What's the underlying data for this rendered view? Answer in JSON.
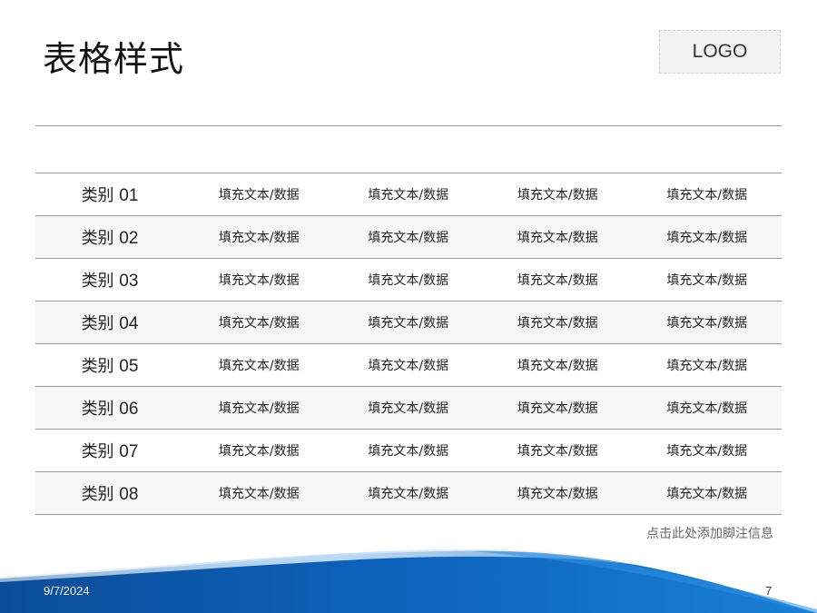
{
  "slide": {
    "title": "表格样式",
    "logo": "LOGO",
    "footnote": "点击此处添加脚注信息",
    "date": "9/7/2024",
    "page_number": "7"
  },
  "table": {
    "rows": [
      {
        "label": "类别",
        "num": "01",
        "cells": [
          "填充文本/数据",
          "填充文本/数据",
          "填充文本/数据",
          "填充文本/数据"
        ]
      },
      {
        "label": "类别",
        "num": "02",
        "cells": [
          "填充文本/数据",
          "填充文本/数据",
          "填充文本/数据",
          "填充文本/数据"
        ]
      },
      {
        "label": "类别",
        "num": "03",
        "cells": [
          "填充文本/数据",
          "填充文本/数据",
          "填充文本/数据",
          "填充文本/数据"
        ]
      },
      {
        "label": "类别",
        "num": "04",
        "cells": [
          "填充文本/数据",
          "填充文本/数据",
          "填充文本/数据",
          "填充文本/数据"
        ]
      },
      {
        "label": "类别",
        "num": "05",
        "cells": [
          "填充文本/数据",
          "填充文本/数据",
          "填充文本/数据",
          "填充文本/数据"
        ]
      },
      {
        "label": "类别",
        "num": "06",
        "cells": [
          "填充文本/数据",
          "填充文本/数据",
          "填充文本/数据",
          "填充文本/数据"
        ]
      },
      {
        "label": "类别",
        "num": "07",
        "cells": [
          "填充文本/数据",
          "填充文本/数据",
          "填充文本/数据",
          "填充文本/数据"
        ]
      },
      {
        "label": "类别",
        "num": "08",
        "cells": [
          "填充文本/数据",
          "填充文本/数据",
          "填充文本/数据",
          "填充文本/数据"
        ]
      }
    ]
  },
  "colors": {
    "wave_dark": "#0a4fa0",
    "wave_light": "#2f8fe0"
  }
}
